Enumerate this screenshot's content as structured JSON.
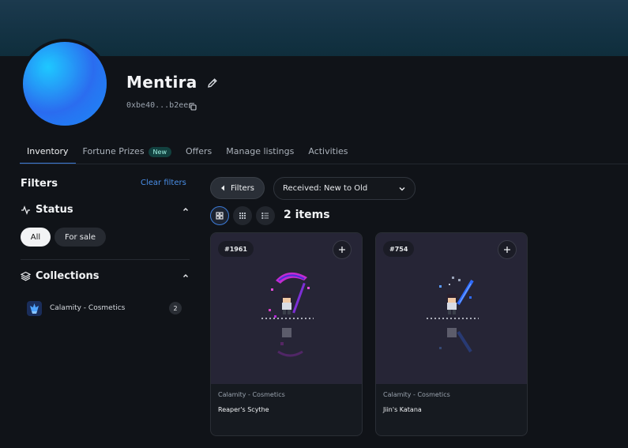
{
  "profile": {
    "name": "Mentira",
    "wallet": "0xbe40...b2ee"
  },
  "tabs": [
    {
      "label": "Inventory",
      "active": true
    },
    {
      "label": "Fortune Prizes",
      "badge": "New"
    },
    {
      "label": "Offers"
    },
    {
      "label": "Manage listings"
    },
    {
      "label": "Activities"
    }
  ],
  "sidebar": {
    "filters_title": "Filters",
    "clear_label": "Clear filters",
    "status": {
      "title": "Status",
      "options": [
        "All",
        "For sale"
      ],
      "selected": "All"
    },
    "collections": {
      "title": "Collections",
      "items": [
        {
          "name": "Calamity - Cosmetics",
          "count": "2"
        }
      ]
    }
  },
  "toolbar": {
    "filters_label": "Filters",
    "sort_value": "Received: New to Old",
    "items_count": "2 items"
  },
  "cards": [
    {
      "id": "#1961",
      "collection": "Calamity - Cosmetics",
      "name": "Reaper's Scythe",
      "accent": "#b02bd6"
    },
    {
      "id": "#754",
      "collection": "Calamity - Cosmetics",
      "name": "Jiin's Katana",
      "accent": "#2f6bff"
    }
  ],
  "colors": {
    "accent": "#3c7bd8",
    "link": "#4a8fe8",
    "background": "#101318"
  }
}
